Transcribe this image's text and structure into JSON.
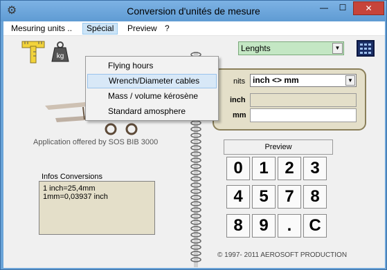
{
  "window": {
    "title": "Conversion d'unités de mesure",
    "min_label": "—",
    "max_label": "☐",
    "close_label": "✕",
    "app_icon": "gear-icon"
  },
  "menubar": {
    "items": [
      {
        "label": "Mesuring units .."
      },
      {
        "label": "Spécial"
      },
      {
        "label": "Preview"
      },
      {
        "label": "?"
      }
    ]
  },
  "special_menu": {
    "items": [
      {
        "label": "Flying hours"
      },
      {
        "label": "Wrench/Diameter  cables"
      },
      {
        "label": "Mass / volume kérosène"
      },
      {
        "label": "Standard amosphere"
      }
    ]
  },
  "toolbar": {
    "category_value": "Lenghts",
    "icons": [
      "ruler-icon",
      "weight-icon",
      "calculator-icon"
    ]
  },
  "offered_text": "Application offered by SOS BIB 3000",
  "infos": {
    "label": "Infos  Conversions",
    "lines": [
      "1 inch=25,4mm",
      "1mm=0,03937 inch"
    ]
  },
  "conversion": {
    "units_label": "nits",
    "units_value": "inch <> mm",
    "field1_label": "inch",
    "field1_value": "",
    "field2_label": "mm",
    "field2_value": ""
  },
  "keypad": {
    "preview_label": "Preview",
    "keys": [
      "0",
      "1",
      "2",
      "3",
      "4",
      "5",
      "7",
      "8",
      "9",
      ".",
      "C"
    ],
    "layout": [
      [
        "0",
        "1",
        "2",
        "3"
      ],
      [
        "4",
        "5",
        "7",
        "8"
      ],
      [
        "8",
        "9",
        ".",
        "C"
      ]
    ]
  },
  "copyright": "©  1997- 2011 AEROSOFT PRODUCTION",
  "colors": {
    "titlebar": "#6aa4d8",
    "close": "#c7443a",
    "panel": "#e4dfc9",
    "lenghts_bg": "#c4e7c4",
    "field_bg": "#e4dfc9"
  }
}
